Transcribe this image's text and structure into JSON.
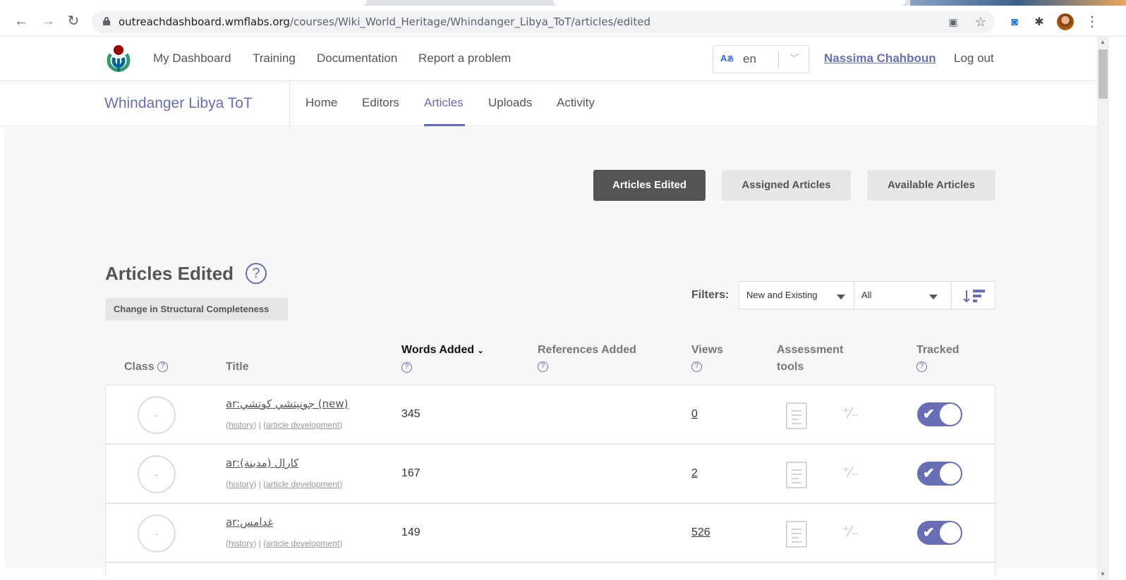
{
  "browser": {
    "url_host": "outreachdashboard.wmflabs.org",
    "url_path": "/courses/Wiki_World_Heritage/Whindanger_Libya_ToT/articles/edited"
  },
  "topnav": {
    "links": [
      "My Dashboard",
      "Training",
      "Documentation",
      "Report a problem"
    ],
    "language": "en",
    "username": "Nassima Chahboun",
    "logout": "Log out"
  },
  "course": {
    "title": "Whindanger Libya ToT",
    "tabs": [
      "Home",
      "Editors",
      "Articles",
      "Uploads",
      "Activity"
    ],
    "active_tab": "Articles"
  },
  "switcher": {
    "edited": "Articles Edited",
    "assigned": "Assigned Articles",
    "available": "Available Articles"
  },
  "section": {
    "heading": "Articles Edited",
    "chip": "Change in Structural Completeness",
    "filters_label": "Filters:",
    "filter1": "New and Existing",
    "filter2": "All"
  },
  "columns": {
    "class": "Class",
    "title": "Title",
    "words_added": "Words Added",
    "references_added": "References Added",
    "views": "Views",
    "assessment": "Assessment",
    "assessment2": "tools",
    "tracked": "Tracked"
  },
  "rows": [
    {
      "class": "-",
      "title": "ar:جونيتشي كوتشي",
      "suffix": " (new)",
      "history": "history",
      "dev": "article development",
      "words": "345",
      "views": "0"
    },
    {
      "class": "-",
      "title": "ar:كارال (مدينة)",
      "suffix": "",
      "history": "history",
      "dev": "article development",
      "words": "167",
      "views": "2"
    },
    {
      "class": "-",
      "title": "ar:غدامس",
      "suffix": "",
      "history": "history",
      "dev": "article development",
      "words": "149",
      "views": "526"
    }
  ],
  "colors": {
    "accent": "#676eb4",
    "dark_button": "#555555",
    "light_button": "#e6e6e6"
  }
}
